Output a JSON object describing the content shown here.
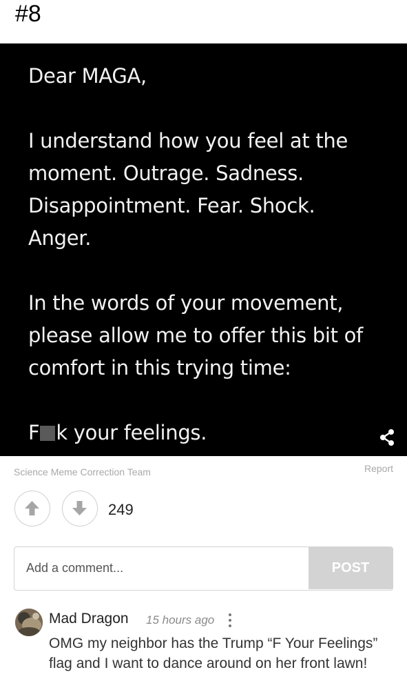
{
  "item_number": "#8",
  "meme": {
    "lines_block1": [
      "Dear MAGA,"
    ],
    "lines_block2": [
      "I understand how you feel at the",
      "moment. Outrage. Sadness.",
      "Disappointment. Fear. Shock.",
      "Anger."
    ],
    "lines_block3": [
      "In the words of your movement,",
      "please allow me to offer this bit of",
      "comfort in this trying time:"
    ],
    "final_line": {
      "prefix": "F",
      "suffix": "k your feelings."
    },
    "share_icon": "share-icon"
  },
  "meta": {
    "source": "Science Meme Correction Team",
    "report_label": "Report"
  },
  "votes": {
    "upvote_icon": "arrow-up-icon",
    "downvote_icon": "arrow-down-icon",
    "count": "249"
  },
  "comment_form": {
    "placeholder": "Add a comment...",
    "post_label": "POST"
  },
  "comment": {
    "author": "Mad Dragon",
    "time": "15 hours ago",
    "text": "OMG my neighbor has the Trump “F Your Feelings” flag and I want to dance around on her front lawn!"
  },
  "colors": {
    "meme_background": "#000000",
    "meme_text": "#f2f2f2",
    "post_button": "#d3d3d3",
    "muted_text": "#a8a8a8"
  }
}
